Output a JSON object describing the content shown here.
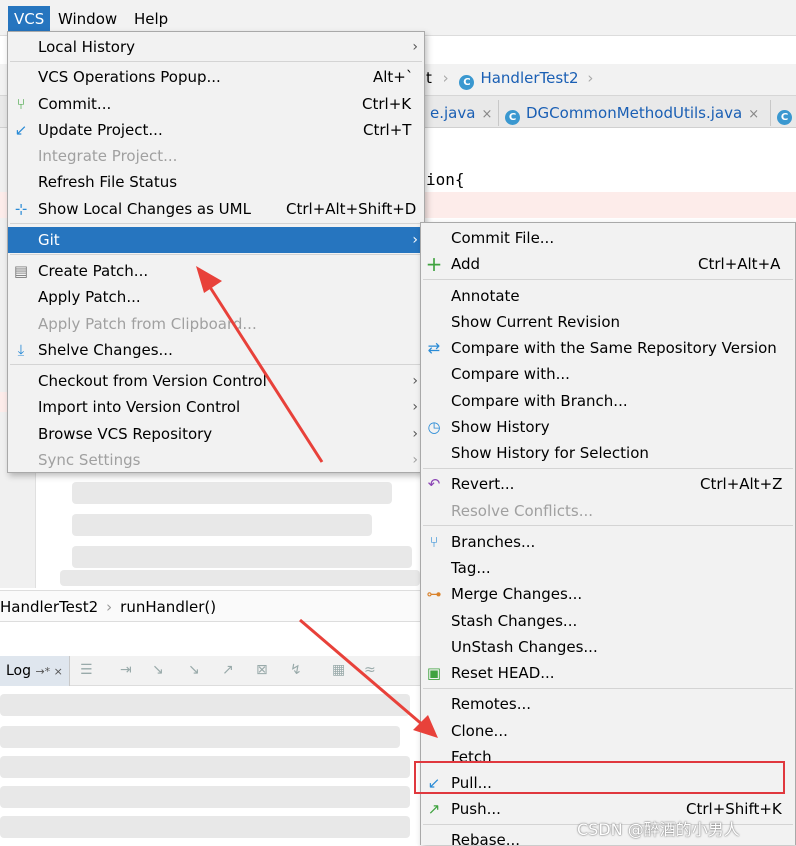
{
  "menubar": {
    "vcs": "VCS",
    "window": "Window",
    "help": "Help"
  },
  "background": {
    "crumb_prefix": "t",
    "crumb_class": "HandlerTest2",
    "tab_partial": "e.java",
    "tab_main": "DGCommonMethodUtils.java",
    "tab_close": "×",
    "class_letter": "C",
    "code_fragment": "ion{",
    "breadcrumb_class": "HandlerTest2",
    "breadcrumb_method": "runHandler()",
    "log_label": "Log",
    "log_pin": "→* ×"
  },
  "vcs_menu": {
    "items": [
      {
        "label": "Local History",
        "shortcut": "",
        "submenu": true,
        "disabled": false
      },
      {
        "label": "VCS Operations Popup...",
        "shortcut": "Alt+`",
        "submenu": false,
        "disabled": false
      },
      {
        "label": "Commit...",
        "shortcut": "Ctrl+K",
        "submenu": false,
        "disabled": false
      },
      {
        "label": "Update Project...",
        "shortcut": "Ctrl+T",
        "submenu": false,
        "disabled": false
      },
      {
        "label": "Integrate Project...",
        "shortcut": "",
        "submenu": false,
        "disabled": true
      },
      {
        "label": "Refresh File Status",
        "shortcut": "",
        "submenu": false,
        "disabled": false
      },
      {
        "label": "Show Local Changes as UML",
        "shortcut": "Ctrl+Alt+Shift+D",
        "submenu": false,
        "disabled": false
      },
      {
        "label": "Git",
        "shortcut": "",
        "submenu": true,
        "disabled": false,
        "selected": true
      },
      {
        "label": "Create Patch...",
        "shortcut": "",
        "submenu": false,
        "disabled": false
      },
      {
        "label": "Apply Patch...",
        "shortcut": "",
        "submenu": false,
        "disabled": false
      },
      {
        "label": "Apply Patch from Clipboard...",
        "shortcut": "",
        "submenu": false,
        "disabled": true
      },
      {
        "label": "Shelve Changes...",
        "shortcut": "",
        "submenu": false,
        "disabled": false
      },
      {
        "label": "Checkout from Version Control",
        "shortcut": "",
        "submenu": true,
        "disabled": false
      },
      {
        "label": "Import into Version Control",
        "shortcut": "",
        "submenu": true,
        "disabled": false
      },
      {
        "label": "Browse VCS Repository",
        "shortcut": "",
        "submenu": true,
        "disabled": false
      },
      {
        "label": "Sync Settings",
        "shortcut": "",
        "submenu": true,
        "disabled": true
      }
    ]
  },
  "git_menu": {
    "items": [
      {
        "label": "Commit File...",
        "shortcut": ""
      },
      {
        "label": "Add",
        "shortcut": "Ctrl+Alt+A"
      },
      {
        "label": "Annotate",
        "shortcut": ""
      },
      {
        "label": "Show Current Revision",
        "shortcut": ""
      },
      {
        "label": "Compare with the Same Repository Version",
        "shortcut": ""
      },
      {
        "label": "Compare with...",
        "shortcut": ""
      },
      {
        "label": "Compare with Branch...",
        "shortcut": ""
      },
      {
        "label": "Show History",
        "shortcut": ""
      },
      {
        "label": "Show History for Selection",
        "shortcut": ""
      },
      {
        "label": "Revert...",
        "shortcut": "Ctrl+Alt+Z"
      },
      {
        "label": "Resolve Conflicts...",
        "shortcut": "",
        "disabled": true
      },
      {
        "label": "Branches...",
        "shortcut": ""
      },
      {
        "label": "Tag...",
        "shortcut": ""
      },
      {
        "label": "Merge Changes...",
        "shortcut": ""
      },
      {
        "label": "Stash Changes...",
        "shortcut": ""
      },
      {
        "label": "UnStash Changes...",
        "shortcut": ""
      },
      {
        "label": "Reset HEAD...",
        "shortcut": ""
      },
      {
        "label": "Remotes...",
        "shortcut": ""
      },
      {
        "label": "Clone...",
        "shortcut": ""
      },
      {
        "label": "Fetch",
        "shortcut": ""
      },
      {
        "label": "Pull...",
        "shortcut": ""
      },
      {
        "label": "Push...",
        "shortcut": "Ctrl+Shift+K"
      },
      {
        "label": "Rebase...",
        "shortcut": ""
      }
    ]
  },
  "icons": {
    "commit": "branch-icon",
    "update": "update-arrow-icon",
    "uml": "uml-diagram-icon",
    "patch": "patch-file-icon",
    "shelve": "shelve-icon",
    "add": "plus-icon",
    "compare": "compare-arrows-icon",
    "history": "history-icon",
    "revert": "revert-icon",
    "branches": "branches-icon",
    "merge": "merge-icon",
    "reset": "reset-head-icon",
    "pull": "pull-arrow-icon",
    "push": "push-arrow-icon"
  },
  "colors": {
    "selection": "#2675bf",
    "highlight_box": "#e0383e",
    "annotation_arrow": "#e8413a",
    "menu_bg": "#f2f2f2",
    "add_green": "#3fa33f"
  },
  "watermark": "CSDN @醉酒的小男人"
}
